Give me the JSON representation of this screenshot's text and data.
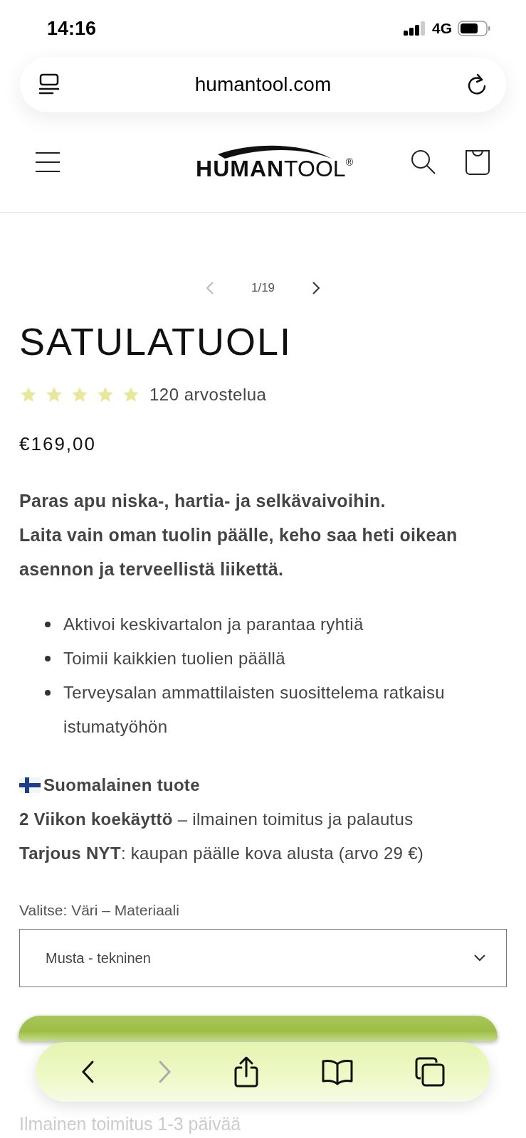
{
  "status_bar": {
    "time": "14:16",
    "network": "4G"
  },
  "browser": {
    "url": "humantool.com"
  },
  "header": {
    "logo_bold": "HUMAN",
    "logo_light": "TOOL",
    "logo_mark": "®"
  },
  "gallery": {
    "counter": "1/19"
  },
  "product": {
    "title": "SATULATUOLI",
    "stars": 5,
    "reviews": "120 arvostelua",
    "price": "€169,00",
    "intro": [
      "Paras apu niska-, hartia- ja selkävaivoihin.",
      "Laita vain oman tuolin päälle, keho saa heti oikean asennon ja terveellistä liikettä."
    ],
    "bullets": [
      "Aktivoi keskivartalon ja parantaa ryhtiä",
      "Toimii kaikkien tuolien päällä",
      "Terveysalan ammattilaisten suosittelema ratkaisu istumatyöhön"
    ],
    "origin": "Suomalainen tuote",
    "offers": [
      "**2 Viikon koekäyttö** – ilmainen toimitus ja palautus",
      "**Tarjous NYT**: kaupan päälle kova alusta (arvo 29 €)"
    ],
    "variant_label": "Valitse: Väri – Materiaali",
    "variant_value": "Musta - tekninen",
    "shipping": "Ilmainen toimitus 1-3 päivää"
  },
  "toolbar": {
    "back_disabled": false,
    "forward_disabled": true
  }
}
